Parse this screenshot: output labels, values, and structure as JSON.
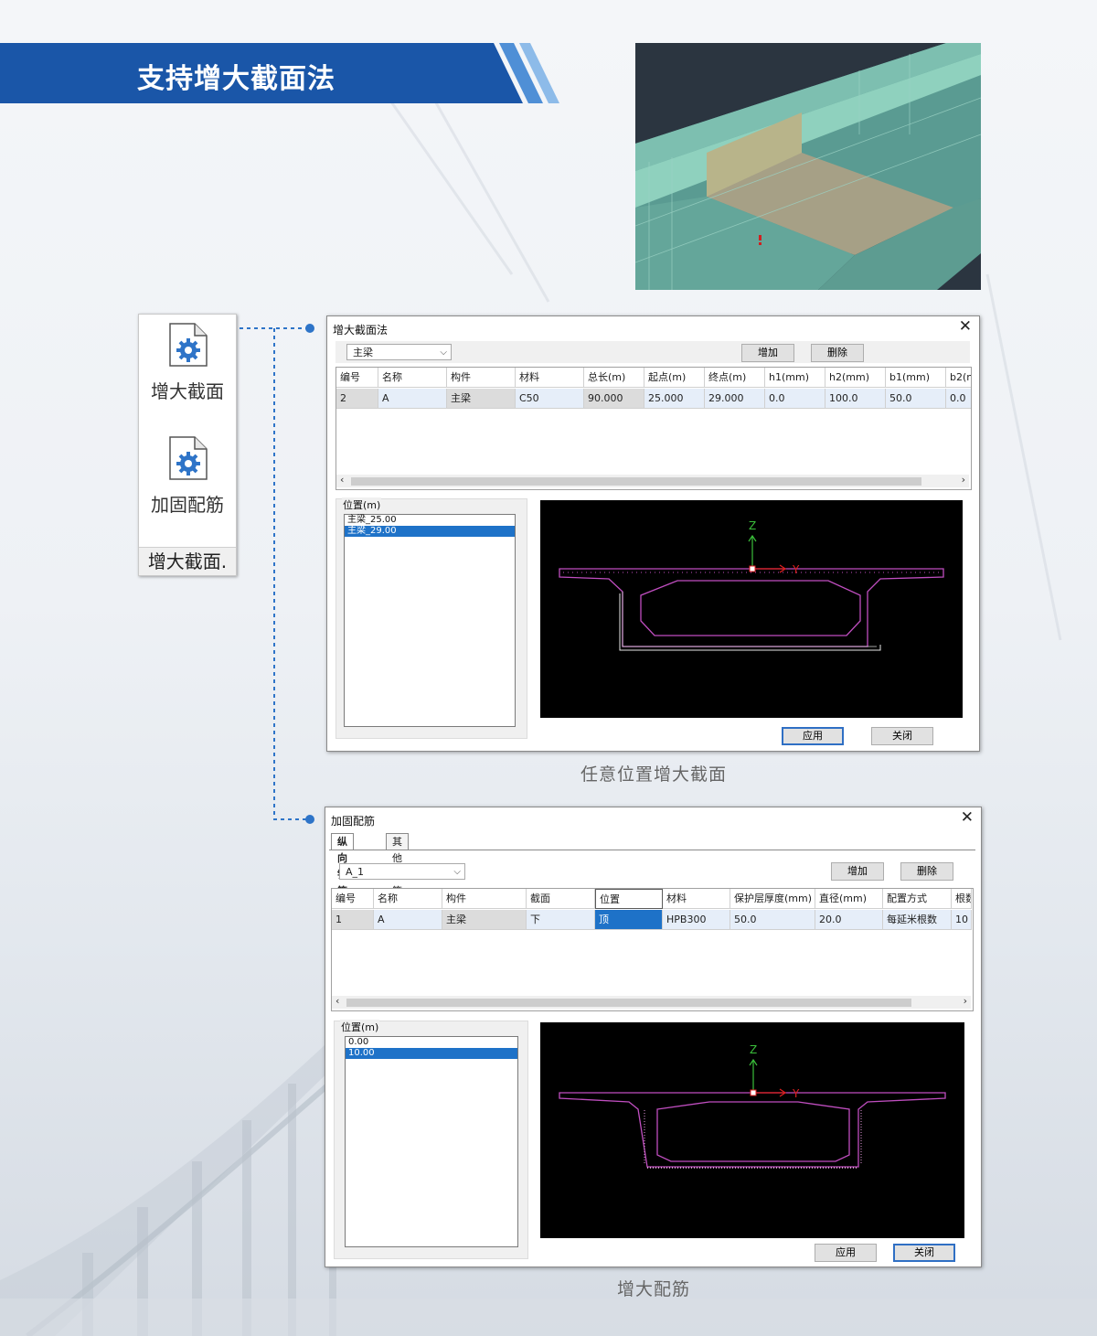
{
  "banner": {
    "title": "支持增大截面法"
  },
  "ribbon": {
    "buttons": [
      {
        "label": "增大截面",
        "icon": "settings-gear-icon"
      },
      {
        "label": "加固配筋",
        "icon": "settings-gear-icon"
      }
    ],
    "group_label": "增大截面."
  },
  "dialog1": {
    "title": "增大截面法",
    "close": "✕",
    "combo_value": "主梁",
    "add_label": "增加",
    "delete_label": "删除",
    "columns": [
      "编号",
      "名称",
      "构件",
      "材料",
      "总长(m)",
      "起点(m)",
      "终点(m)",
      "h1(mm)",
      "h2(mm)",
      "b1(mm)",
      "b2(n"
    ],
    "rows": [
      [
        "2",
        "A",
        "主梁",
        "C50",
        "90.000",
        "25.000",
        "29.000",
        "0.0",
        "100.0",
        "50.0",
        "0.0"
      ]
    ],
    "position_label": "位置(m)",
    "positions": [
      "主梁_25.00",
      "主梁_29.00"
    ],
    "selected_position": 1,
    "axis_z": "Z",
    "axis_y": "Y",
    "apply_label": "应用",
    "close_label": "关闭",
    "caption": "任意位置增大截面"
  },
  "dialog2": {
    "title": "加固配筋",
    "close": "✕",
    "tabs": [
      "纵向钢筋",
      "其他钢筋"
    ],
    "combo_value": "A_1",
    "add_label": "增加",
    "delete_label": "删除",
    "columns": [
      "编号",
      "名称",
      "构件",
      "截面",
      "位置",
      "材料",
      "保护层厚度(mm)",
      "直径(mm)",
      "配置方式",
      "根数"
    ],
    "rows": [
      [
        "1",
        "A",
        "主梁",
        "下",
        "顶",
        "HPB300",
        "50.0",
        "20.0",
        "每延米根数",
        "10"
      ]
    ],
    "position_label": "位置(m)",
    "positions": [
      "0.00",
      "10.00"
    ],
    "selected_position": 1,
    "axis_z": "Z",
    "axis_y": "Y",
    "apply_label": "应用",
    "close_label": "关闭",
    "caption": "增大配筋"
  },
  "colors": {
    "brand_blue": "#1a56a8",
    "select_blue": "#1e72c8",
    "section_magenta": "#c04ec0",
    "axis_green": "#3bbf3b",
    "axis_red": "#e02020"
  }
}
